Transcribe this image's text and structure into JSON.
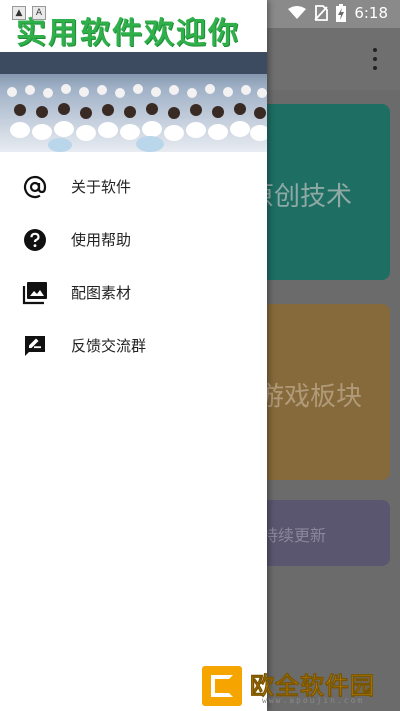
{
  "status_bar": {
    "time": "6:18",
    "notification_glyphs": [
      "▲",
      "A"
    ]
  },
  "drawer": {
    "title": "实用软件欢迎你",
    "items": [
      {
        "label": "关于软件",
        "icon": "at-sign-icon"
      },
      {
        "label": "使用帮助",
        "icon": "help-circle-icon"
      },
      {
        "label": "配图素材",
        "icon": "photo-library-icon"
      },
      {
        "label": "反馈交流群",
        "icon": "feedback-icon"
      }
    ]
  },
  "main": {
    "cards": [
      {
        "label": "原创技术",
        "color": "#1e6e64"
      },
      {
        "label": "游戏板块",
        "color": "#866a3c"
      },
      {
        "label": "持续更新",
        "color": "#5b5670"
      }
    ]
  },
  "watermark": {
    "name": "欧全软件园",
    "url": "www.apoujin.com"
  },
  "colors": {
    "title_green": "#2fb04a",
    "scrim": "#6b6b6b",
    "watermark_orange": "#f5a400"
  }
}
